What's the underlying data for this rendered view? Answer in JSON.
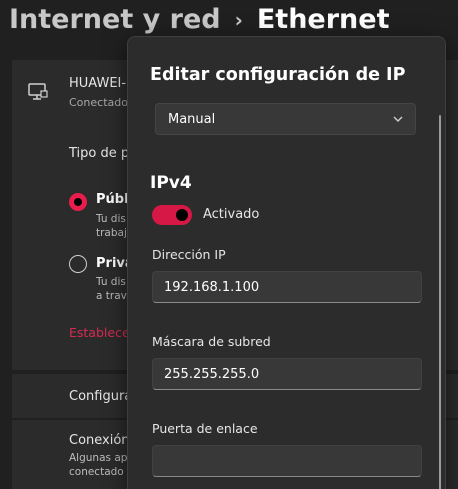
{
  "breadcrumb": {
    "parent": "Internet y red",
    "separator": "›",
    "current": "Ethernet"
  },
  "connection": {
    "name": "HUAWEI-",
    "status": "Conectado",
    "icon": "ethernet-monitor-icon"
  },
  "network_profile": {
    "label": "Tipo de p",
    "options": [
      {
        "title": "Públi",
        "desc_lines": [
          "Tu dis",
          "trabaj"
        ],
        "selected": true
      },
      {
        "title": "Priva",
        "desc_lines": [
          "Tu dis",
          "a trav"
        ],
        "selected": false
      }
    ],
    "firewall_link": "Establece"
  },
  "ip_config_row": "Configura",
  "metered": {
    "title": "Conexión",
    "desc_lines": [
      "Algunas ap",
      "conectado"
    ]
  },
  "dialog": {
    "title": "Editar configuración de IP",
    "mode_select": "Manual",
    "section": "IPv4",
    "toggle_label": "Activado",
    "fields": [
      {
        "label": "Dirección IP",
        "value": "192.168.1.100"
      },
      {
        "label": "Máscara de subred",
        "value": "255.255.255.0"
      },
      {
        "label": "Puerta de enlace",
        "value": ""
      }
    ]
  },
  "colors": {
    "accent": "#e81d4e",
    "background": "#202020",
    "card": "#2b2b2b",
    "dialog": "#2c2c2c"
  }
}
